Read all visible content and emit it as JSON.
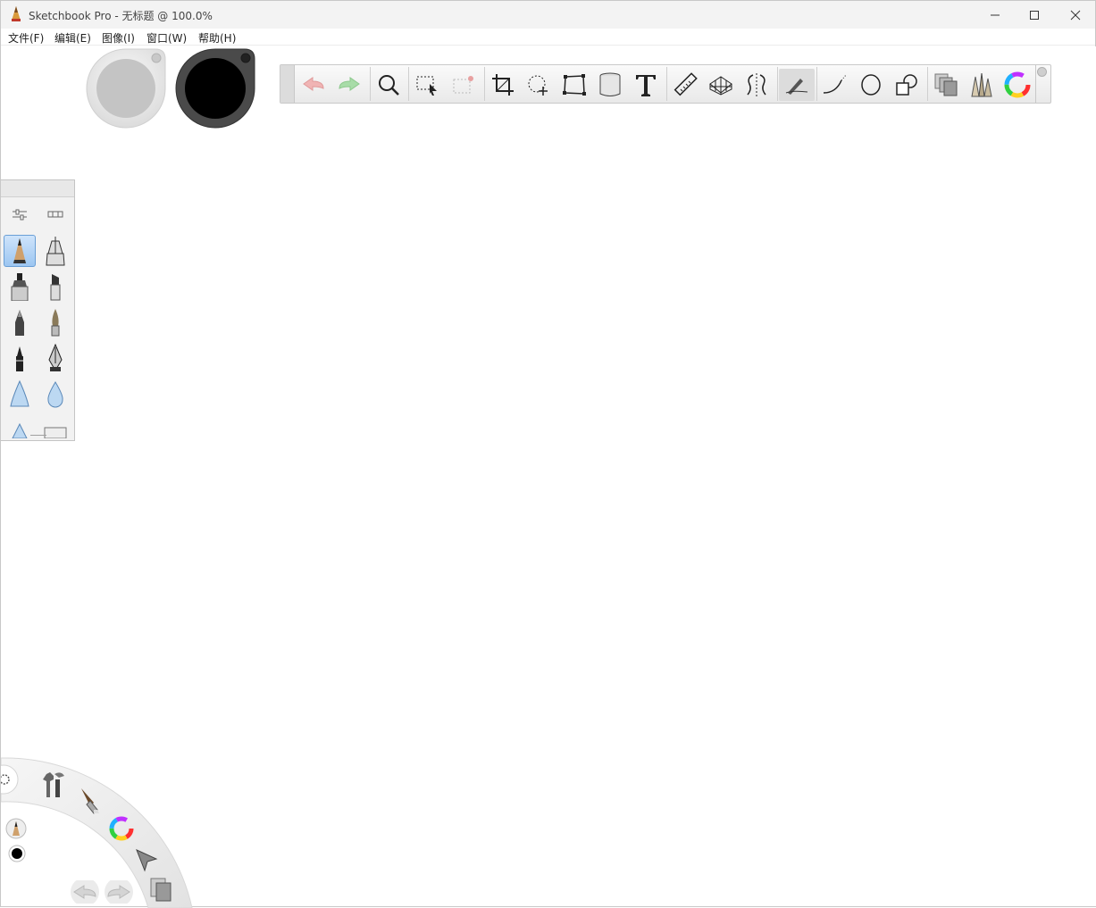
{
  "window": {
    "title": "Sketchbook Pro - 无标题 @ 100.0%"
  },
  "menu": {
    "items": [
      "文件(F)",
      "编辑(E)",
      "图像(I)",
      "窗口(W)",
      "帮助(H)"
    ]
  },
  "pucks": {
    "brush_puck_color": "#c4c4c4",
    "color_puck_color": "#000000"
  },
  "toolbar": {
    "tools": [
      "undo-icon",
      "redo-icon",
      "zoom-icon",
      "rectangle-select-icon",
      "magic-select-icon",
      "crop-icon",
      "lasso-move-icon",
      "distort-icon",
      "fill-bucket-icon",
      "text-icon",
      "ruler-icon",
      "perspective-icon",
      "symmetry-icon",
      "pen-stroke-icon",
      "curve-icon",
      "ellipse-icon",
      "shapes-icon",
      "layers-icon",
      "brushes-icon",
      "color-wheel-icon"
    ],
    "active_tool": "pen-stroke-icon"
  },
  "brush_palette": {
    "selected": "pencil",
    "brushes": [
      "pencil",
      "technical-pen",
      "marker",
      "chisel-marker",
      "ballpoint",
      "paintbrush",
      "ink-pen",
      "fountain-pen",
      "airbrush",
      "water-drop",
      "triangle-brush",
      "eraser"
    ]
  },
  "lagoon": {
    "items": [
      "settings-icon",
      "tools-icon",
      "brush-icon",
      "color-wheel-icon",
      "select-arrow-icon",
      "layers-icon",
      "undo-icon",
      "redo-icon",
      "current-brush-icon",
      "current-color-icon"
    ]
  },
  "colors": {
    "titlebar": "#f3f3f3",
    "toolbar": "#ececec",
    "selection": "#9cc6f1",
    "undo_tint": "#e8a0a0",
    "redo_tint": "#8fd08f"
  }
}
